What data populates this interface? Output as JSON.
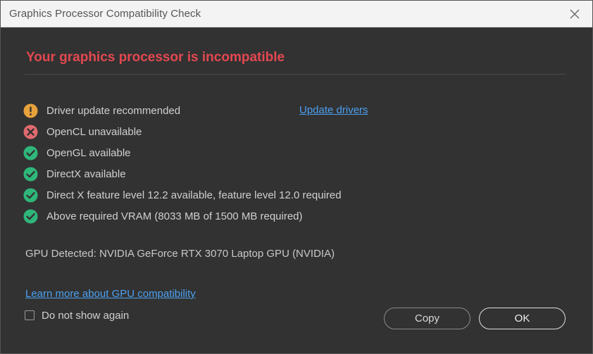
{
  "window": {
    "title": "Graphics Processor Compatibility Check",
    "close_icon": "close-icon"
  },
  "headline": "Your graphics processor is incompatible",
  "colors": {
    "error": "#e34850",
    "warning": "#e8a23c",
    "success": "#2fb67a",
    "link": "#4ba0f0"
  },
  "checks": [
    {
      "status": "warning",
      "icon": "warning-icon",
      "label": "Driver update recommended"
    },
    {
      "status": "error",
      "icon": "error-icon",
      "label": "OpenCL unavailable"
    },
    {
      "status": "success",
      "icon": "checkmark-icon",
      "label": "OpenGL available"
    },
    {
      "status": "success",
      "icon": "checkmark-icon",
      "label": "DirectX available"
    },
    {
      "status": "success",
      "icon": "checkmark-icon",
      "label": "Direct X feature level 12.2 available, feature level 12.0 required"
    },
    {
      "status": "success",
      "icon": "checkmark-icon",
      "label": "Above required VRAM (8033 MB of 1500 MB required)"
    }
  ],
  "update_drivers_link": "Update drivers",
  "gpu_detected": "GPU Detected: NVIDIA GeForce RTX 3070 Laptop GPU (NVIDIA)",
  "learn_more_link": "Learn more about GPU compatibility",
  "do_not_show": {
    "label": "Do not show again",
    "checked": false
  },
  "buttons": {
    "copy": "Copy",
    "ok": "OK"
  }
}
